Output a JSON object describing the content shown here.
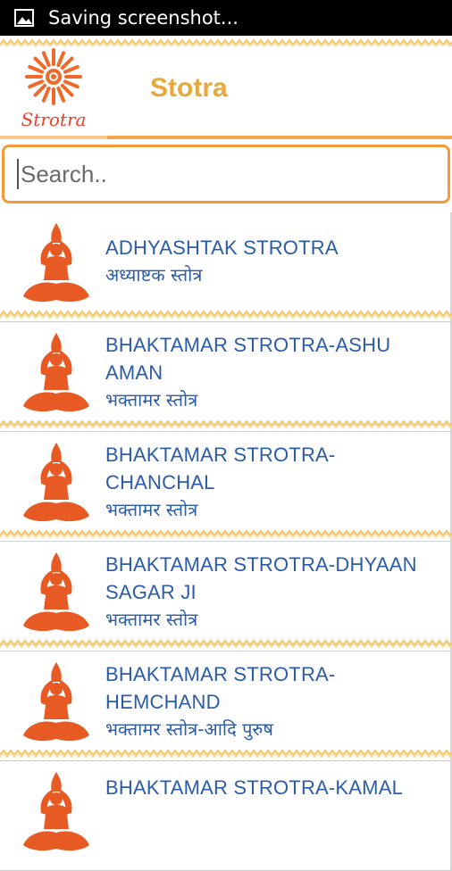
{
  "statusbar": {
    "icon": "image-icon",
    "text": "Saving screenshot..."
  },
  "header": {
    "logo_text": "Strotra",
    "title": "Stotra"
  },
  "search": {
    "placeholder": "Search.."
  },
  "colors": {
    "accent_orange": "#f39a3a",
    "title_gold": "#e8a83a",
    "item_blue": "#2b5ca8",
    "figure_orange": "#e85a24",
    "logo_red": "#e8412c"
  },
  "items": [
    {
      "name": "ADHYASHTAK STROTRA",
      "hindi": "अध्याष्टक स्तोत्र",
      "icon": "yoga-figure-icon"
    },
    {
      "name": "BHAKTAMAR STROTRA-ASHU AMAN",
      "hindi": "भक्तामर स्तोत्र",
      "icon": "yoga-figure-icon"
    },
    {
      "name": "BHAKTAMAR STROTRA-CHANCHAL",
      "hindi": "भक्तामर स्तोत्र",
      "icon": "yoga-figure-icon"
    },
    {
      "name": "BHAKTAMAR STROTRA-DHYAAN SAGAR JI",
      "hindi": "भक्तामर स्तोत्र",
      "icon": "yoga-figure-icon"
    },
    {
      "name": "BHAKTAMAR STROTRA-HEMCHAND",
      "hindi": "भक्तामर स्तोत्र-आदि पुरुष",
      "icon": "yoga-figure-icon"
    },
    {
      "name": "BHAKTAMAR STROTRA-KAMAL",
      "hindi": "",
      "icon": "yoga-figure-icon"
    }
  ]
}
